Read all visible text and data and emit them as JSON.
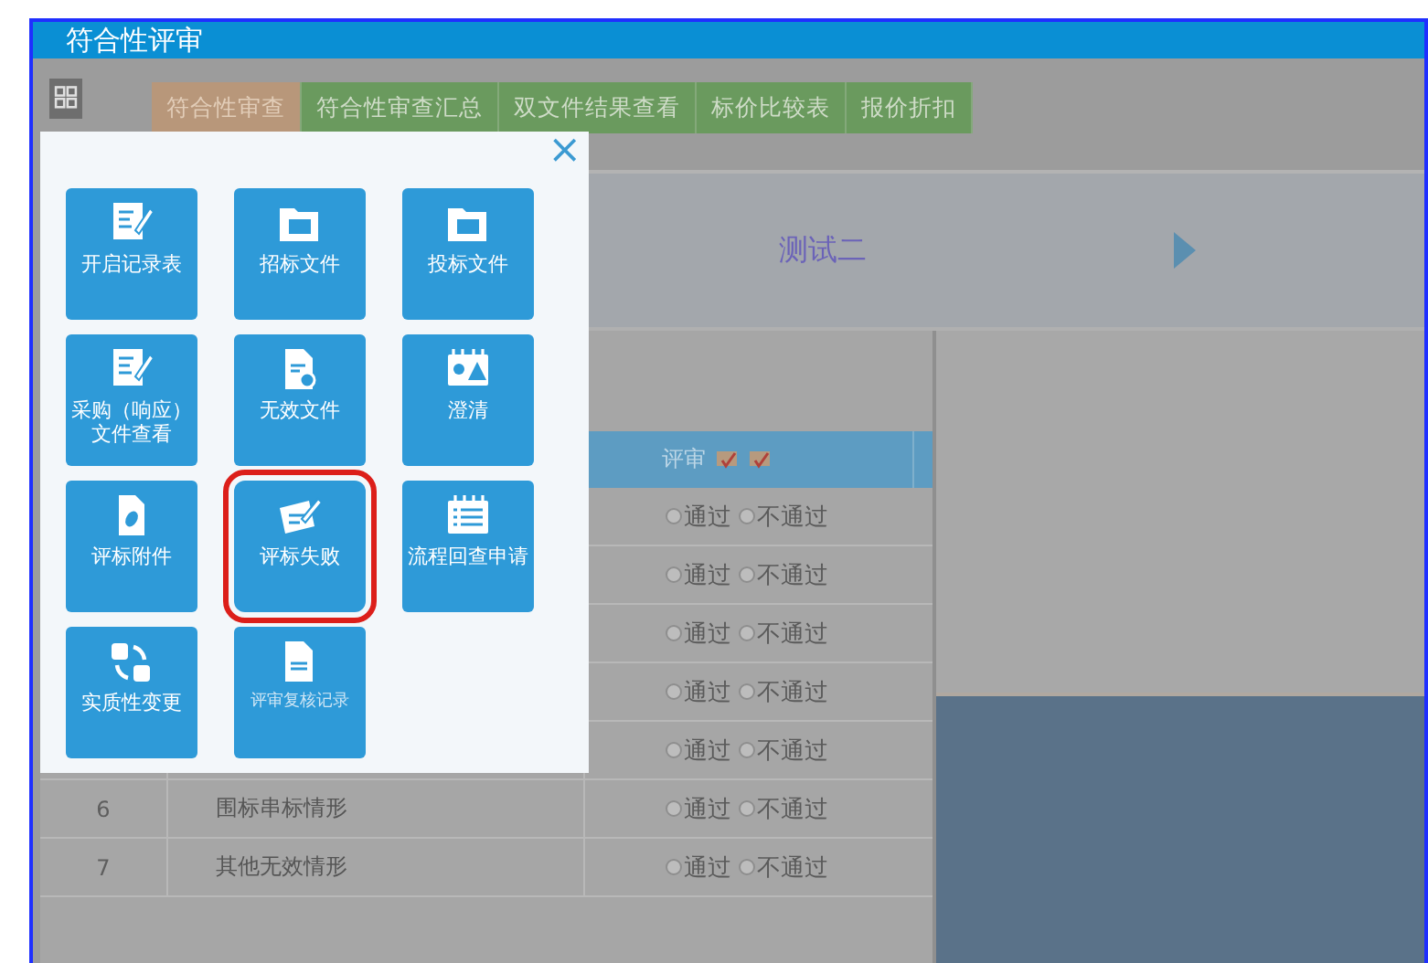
{
  "window": {
    "title": "符合性评审"
  },
  "tabs": [
    {
      "label": "符合性审查",
      "selected": true
    },
    {
      "label": "符合性审查汇总",
      "selected": false
    },
    {
      "label": "双文件结果查看",
      "selected": false
    },
    {
      "label": "标价比较表",
      "selected": false
    },
    {
      "label": "报价折扣",
      "selected": false
    }
  ],
  "banner": {
    "title": "测试二"
  },
  "table": {
    "review_header": "评审",
    "rows": [
      {
        "options": [
          {
            "label": "通过",
            "selected": false
          },
          {
            "label": "不通过",
            "selected": false
          }
        ]
      },
      {
        "options": [
          {
            "label": "通过",
            "selected": false
          },
          {
            "label": "不通过",
            "selected": false
          }
        ]
      },
      {
        "options": [
          {
            "label": "通过",
            "selected": false
          },
          {
            "label": "不通过",
            "selected": false
          }
        ]
      },
      {
        "options": [
          {
            "label": "通过",
            "selected": false
          },
          {
            "label": "不通过",
            "selected": false
          }
        ]
      },
      {
        "options": [
          {
            "label": "通过",
            "selected": false
          },
          {
            "label": "不通过",
            "selected": false
          }
        ]
      },
      {
        "number": "6",
        "name": "围标串标情形",
        "options": [
          {
            "label": "通过",
            "selected": false
          },
          {
            "label": "不通过",
            "selected": false
          }
        ]
      },
      {
        "number": "7",
        "name": "其他无效情形",
        "options": [
          {
            "label": "通过",
            "selected": false
          },
          {
            "label": "不通过",
            "selected": false
          }
        ]
      }
    ]
  },
  "popup": {
    "close": "×",
    "tiles": [
      {
        "label": "开启记录表",
        "highlighted": false
      },
      {
        "label": "招标文件",
        "highlighted": false
      },
      {
        "label": "投标文件",
        "highlighted": false
      },
      {
        "label": "采购（响应）文件查看",
        "highlighted": false
      },
      {
        "label": "无效文件",
        "highlighted": false
      },
      {
        "label": "澄清",
        "highlighted": false
      },
      {
        "label": "评标附件",
        "highlighted": false
      },
      {
        "label": "评标失败",
        "highlighted": true
      },
      {
        "label": "流程回查申请",
        "highlighted": false
      },
      {
        "label": "实质性变更",
        "highlighted": false
      },
      {
        "label": "评审复核记录",
        "highlighted": false
      }
    ]
  }
}
